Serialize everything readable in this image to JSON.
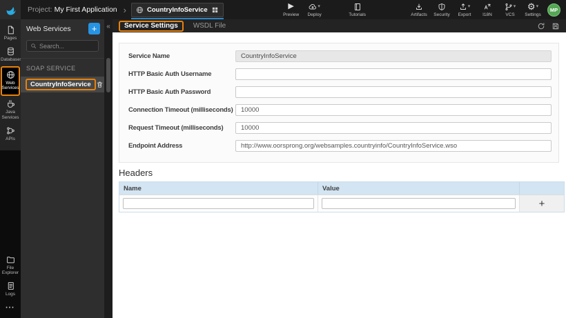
{
  "topbar": {
    "project_label": "Project:",
    "project_name": "My First Application",
    "service_tab_label": "CountryInfoService",
    "actions": {
      "preview": "Preview",
      "deploy": "Deploy",
      "tutorials": "Tutorials",
      "artifacts": "Artifacts",
      "security": "Security",
      "export": "Export",
      "i18n": "I18N",
      "vcs": "VCS",
      "settings": "Settings"
    },
    "avatar_initials": "MP"
  },
  "icons": {
    "play": "▶",
    "caret_down": "▾",
    "gear": "⚙",
    "chevron_right": "›",
    "collapse": "«",
    "more": "•••"
  },
  "sidebar": {
    "pages": "Pages",
    "databases": "Databases",
    "web_services": "Web Services",
    "java_services": "Java Services",
    "apis": "APIs",
    "file_explorer": "File Explorer",
    "logs": "Logs"
  },
  "panel": {
    "title": "Web Services",
    "add_label": "+",
    "search_placeholder": "Search...",
    "section_label": "SOAP SERVICE",
    "service_item": "CountryInfoService"
  },
  "tabs": {
    "service_settings": "Service Settings",
    "wsdl_file": "WSDL File"
  },
  "form": {
    "fields": [
      {
        "label": "Service Name",
        "value": "CountryInfoService"
      },
      {
        "label": "HTTP Basic Auth Username",
        "value": ""
      },
      {
        "label": "HTTP Basic Auth Password",
        "value": ""
      },
      {
        "label": "Connection Timeout (milliseconds)",
        "value": "10000"
      },
      {
        "label": "Request Timeout (milliseconds)",
        "value": "10000"
      },
      {
        "label": "Endpoint Address",
        "value": "http://www.oorsprong.org/websamples.countryinfo/CountryInfoService.wso"
      }
    ]
  },
  "headers_section": {
    "title": "Headers",
    "columns": [
      "Name",
      "Value"
    ],
    "add_label": "+"
  },
  "colors": {
    "highlight_orange": "#E8820C",
    "accent_blue": "#2793E3",
    "tab_indicator_blue": "#2D87C8",
    "avatar_green": "#54A754",
    "table_header_blue": "#D3E4F2"
  }
}
